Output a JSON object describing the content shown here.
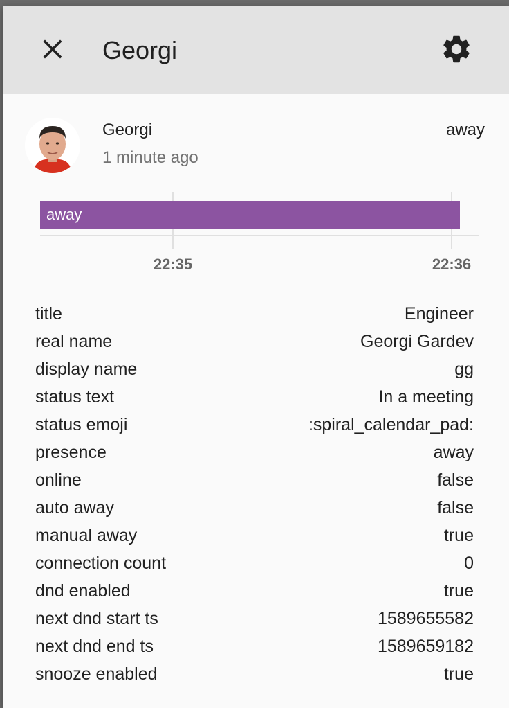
{
  "header": {
    "title": "Georgi",
    "close_icon": "close-icon",
    "settings_icon": "gear-icon"
  },
  "entity": {
    "name": "Georgi",
    "last_changed": "1 minute ago",
    "state": "away",
    "avatar_icon": "user-avatar"
  },
  "timeline": {
    "segments": [
      {
        "label": "away",
        "color": "#8c54a1"
      }
    ],
    "ticks": [
      "22:35",
      "22:36"
    ]
  },
  "attributes": [
    {
      "key": "title",
      "value": "Engineer"
    },
    {
      "key": "real name",
      "value": "Georgi Gardev"
    },
    {
      "key": "display name",
      "value": "gg"
    },
    {
      "key": "status text",
      "value": "In a meeting"
    },
    {
      "key": "status emoji",
      "value": ":spiral_calendar_pad:"
    },
    {
      "key": "presence",
      "value": "away"
    },
    {
      "key": "online",
      "value": "false"
    },
    {
      "key": "auto away",
      "value": "false"
    },
    {
      "key": "manual away",
      "value": "true"
    },
    {
      "key": "connection count",
      "value": "0"
    },
    {
      "key": "dnd enabled",
      "value": "true"
    },
    {
      "key": "next dnd start ts",
      "value": "1589655582"
    },
    {
      "key": "next dnd end ts",
      "value": "1589659182"
    },
    {
      "key": "snooze enabled",
      "value": "true"
    }
  ],
  "colors": {
    "header_bg": "#e3e3e3",
    "dialog_bg": "#fafafa",
    "away_bar": "#8c54a1",
    "secondary_text": "#727272"
  }
}
